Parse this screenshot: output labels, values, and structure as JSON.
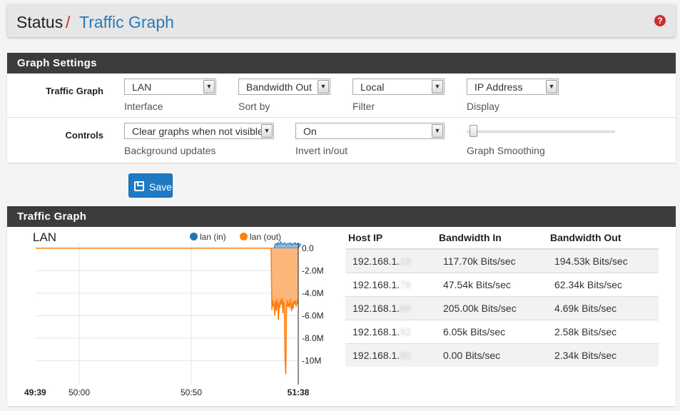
{
  "header": {
    "status": "Status",
    "separator": "/",
    "page": "Traffic Graph",
    "help_icon": "question-circle-icon"
  },
  "settings": {
    "title": "Graph Settings",
    "traffic_graph_label": "Traffic Graph",
    "controls_label": "Controls",
    "interface": {
      "value": "LAN",
      "help": "Interface"
    },
    "sort_by": {
      "value": "Bandwidth Out",
      "help": "Sort by"
    },
    "filter": {
      "value": "Local",
      "help": "Filter"
    },
    "display": {
      "value": "IP Address",
      "help": "Display"
    },
    "background_updates": {
      "value": "Clear graphs when not visible",
      "help": "Background updates"
    },
    "invert": {
      "value": "On",
      "help": "Invert in/out"
    },
    "smoothing": {
      "help": "Graph Smoothing",
      "level": 0
    },
    "save_label": "Save"
  },
  "graph": {
    "title": "Traffic Graph",
    "chart_data": {
      "type": "area",
      "title": "LAN",
      "series": [
        {
          "name": "lan (in)",
          "color": "#1f77b4"
        },
        {
          "name": "lan (out)",
          "color": "#ff7f0e"
        }
      ],
      "x_ticks": [
        "49:39",
        "50:00",
        "50:50",
        "51:38"
      ],
      "y_ticks": [
        "0.0",
        "-2.0M",
        "-4.0M",
        "-6.0M",
        "-8.0M",
        "-10M"
      ],
      "ylim": [
        -11500000,
        500000
      ],
      "in_values": [
        0,
        0,
        0,
        0,
        0,
        0,
        0,
        0,
        0,
        0,
        0,
        0,
        0,
        0,
        0,
        0,
        0,
        0,
        0,
        0,
        0,
        0,
        0,
        0,
        0,
        0,
        0,
        0,
        0,
        0,
        0,
        0,
        0,
        0,
        0,
        0,
        0,
        0,
        0,
        0,
        0,
        0,
        0,
        0,
        0,
        0,
        0,
        0,
        0,
        0,
        0,
        0,
        0,
        0,
        0,
        0,
        0,
        0,
        0,
        0,
        0,
        0,
        0,
        0,
        0,
        0,
        0,
        0,
        0,
        0,
        0,
        0,
        0,
        0,
        0,
        0,
        0,
        0,
        0,
        0,
        0,
        0,
        0,
        0,
        0,
        0,
        0,
        0,
        0,
        0,
        0,
        0,
        0,
        0,
        0,
        0,
        0,
        0,
        0,
        0,
        0,
        0,
        0,
        0,
        0,
        0,
        0,
        0,
        0,
        0,
        0,
        0,
        0,
        0,
        0,
        0,
        0,
        0,
        0,
        0,
        0,
        0,
        0,
        0,
        0,
        0,
        0,
        0,
        0,
        0,
        0,
        0,
        0,
        0,
        0,
        0,
        0,
        0,
        0,
        0,
        0,
        0,
        0,
        0,
        0,
        0,
        0,
        0,
        0,
        0,
        0,
        0,
        0,
        0,
        0,
        0,
        0,
        0,
        0,
        0,
        0,
        0,
        0,
        0,
        0,
        0,
        0,
        0,
        0,
        0,
        0,
        0,
        0,
        0,
        0,
        0,
        0,
        0,
        0,
        0,
        0,
        0,
        0,
        0,
        0,
        0,
        0,
        0,
        0,
        0,
        0,
        0,
        0,
        0,
        0,
        0,
        0,
        0,
        0,
        0,
        0,
        0,
        0,
        0,
        0,
        0,
        0,
        0,
        0,
        0,
        0,
        0,
        0,
        0,
        0,
        0,
        0,
        0,
        0,
        0,
        0,
        0,
        0,
        0,
        0,
        0,
        0,
        0,
        0,
        0,
        0,
        0,
        0,
        0,
        0,
        0,
        0,
        0,
        0,
        0,
        0,
        0,
        0,
        0,
        0,
        0,
        0,
        0,
        0,
        0,
        0,
        0,
        0,
        0,
        0,
        0,
        0,
        0,
        0,
        0,
        0,
        0,
        0,
        0,
        0,
        0,
        0,
        0,
        0,
        0,
        0,
        0,
        0,
        0,
        0,
        0,
        0,
        0,
        0,
        0,
        0,
        0,
        0,
        0,
        0,
        0,
        0,
        0,
        0,
        0,
        0,
        0,
        0,
        0,
        0,
        0,
        0,
        0,
        0,
        0,
        0,
        0,
        0,
        0,
        0,
        0,
        0,
        0,
        0,
        0,
        0,
        0,
        0,
        0,
        0,
        0,
        0,
        0,
        0,
        0,
        0,
        0,
        0,
        0,
        0,
        0,
        300000,
        400000,
        350000,
        450000,
        300000,
        500000,
        400000,
        350000,
        600000,
        450000,
        400000,
        350000,
        450000,
        400000,
        500000,
        350000,
        300000,
        400000,
        450000,
        350000,
        400000,
        500000,
        450000,
        300000,
        400000,
        350000,
        450000,
        400000,
        500000,
        350000,
        400000,
        350000,
        450000,
        400000,
        350000,
        300000,
        400000
      ],
      "out_values": [
        0,
        0,
        0,
        0,
        0,
        0,
        0,
        0,
        0,
        0,
        0,
        0,
        0,
        0,
        0,
        0,
        0,
        0,
        0,
        0,
        0,
        0,
        0,
        0,
        0,
        0,
        0,
        0,
        0,
        0,
        0,
        0,
        0,
        0,
        0,
        0,
        0,
        0,
        0,
        0,
        0,
        0,
        0,
        0,
        0,
        0,
        0,
        0,
        0,
        0,
        0,
        0,
        0,
        0,
        0,
        0,
        0,
        0,
        0,
        0,
        0,
        0,
        0,
        0,
        0,
        0,
        0,
        0,
        0,
        0,
        0,
        0,
        0,
        0,
        0,
        0,
        0,
        0,
        0,
        0,
        0,
        0,
        0,
        0,
        0,
        0,
        0,
        0,
        0,
        0,
        0,
        0,
        0,
        0,
        0,
        0,
        0,
        0,
        0,
        0,
        0,
        0,
        0,
        0,
        0,
        0,
        0,
        0,
        0,
        0,
        0,
        0,
        0,
        0,
        0,
        0,
        0,
        0,
        0,
        0,
        0,
        0,
        0,
        0,
        0,
        0,
        0,
        0,
        0,
        0,
        0,
        0,
        0,
        0,
        0,
        0,
        0,
        0,
        0,
        0,
        0,
        0,
        0,
        0,
        0,
        0,
        0,
        0,
        0,
        0,
        0,
        0,
        0,
        0,
        0,
        0,
        0,
        0,
        0,
        0,
        0,
        0,
        0,
        0,
        0,
        0,
        0,
        0,
        0,
        0,
        0,
        0,
        0,
        0,
        0,
        0,
        0,
        0,
        0,
        0,
        0,
        0,
        0,
        0,
        0,
        0,
        0,
        0,
        0,
        0,
        0,
        0,
        0,
        0,
        0,
        0,
        0,
        0,
        0,
        0,
        0,
        0,
        0,
        0,
        0,
        0,
        0,
        0,
        0,
        0,
        0,
        0,
        0,
        0,
        0,
        0,
        0,
        0,
        0,
        0,
        0,
        0,
        0,
        0,
        0,
        0,
        0,
        0,
        0,
        0,
        0,
        0,
        0,
        0,
        0,
        0,
        0,
        0,
        0,
        0,
        0,
        0,
        0,
        0,
        0,
        0,
        0,
        0,
        0,
        0,
        0,
        0,
        0,
        0,
        0,
        0,
        0,
        0,
        0,
        0,
        0,
        0,
        0,
        0,
        0,
        0,
        0,
        0,
        0,
        0,
        0,
        0,
        0,
        0,
        0,
        0,
        0,
        0,
        0,
        0,
        0,
        0,
        0,
        0,
        0,
        0,
        0,
        0,
        0,
        0,
        0,
        0,
        0,
        0,
        0,
        0,
        0,
        0,
        0,
        0,
        0,
        0,
        0,
        0,
        0,
        0,
        0,
        0,
        0,
        0,
        0,
        0,
        0,
        0,
        0,
        0,
        0,
        0,
        0,
        0,
        0,
        0,
        -5500000,
        -4600000,
        -5200000,
        -4900000,
        -6000000,
        -4700000,
        -5600000,
        -4500000,
        -5100000,
        -6400000,
        -4800000,
        -5300000,
        -4600000,
        -5000000,
        -4400000,
        -5800000,
        -4700000,
        -5400000,
        -10000000,
        -11200000,
        -5500000,
        -4600000,
        -5200000,
        -4900000,
        -5300000,
        -4500000,
        -5100000,
        -5600000,
        -4800000,
        -5400000,
        -4700000,
        -5000000,
        -4600000,
        -5200000,
        -4900000,
        -4700000,
        -5000000
      ]
    }
  },
  "table": {
    "headers": [
      "Host IP",
      "Bandwidth In",
      "Bandwidth Out"
    ],
    "rows": [
      {
        "ip": "192.168.1.",
        "ip_suffix": "18",
        "in": "117.70k Bits/sec",
        "out": "194.53k Bits/sec"
      },
      {
        "ip": "192.168.1.",
        "ip_suffix": "76",
        "in": "47.54k Bits/sec",
        "out": "62.34k Bits/sec"
      },
      {
        "ip": "192.168.1.",
        "ip_suffix": "88",
        "in": "205.00k Bits/sec",
        "out": "4.69k Bits/sec"
      },
      {
        "ip": "192.168.1.",
        "ip_suffix": "92",
        "in": "6.05k Bits/sec",
        "out": "2.58k Bits/sec"
      },
      {
        "ip": "192.168.1.",
        "ip_suffix": "80",
        "in": "0.00 Bits/sec",
        "out": "2.34k Bits/sec"
      }
    ]
  }
}
